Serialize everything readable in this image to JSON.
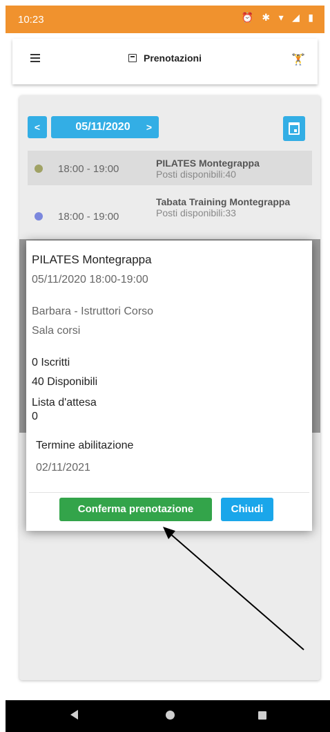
{
  "status_bar": {
    "time": "10:23",
    "icons": "⏰ ✱ ▾ ◢ ▮"
  },
  "header": {
    "title": "Prenotazioni",
    "menu_icon": "hamburger-icon",
    "calendar_icon": "calendar-icon",
    "right_icon": "fitness-icon"
  },
  "date_nav": {
    "prev": "<",
    "date": "05/11/2020",
    "next": ">"
  },
  "classes": [
    {
      "time": "18:00 - 19:00",
      "name": "PILATES Montegrappa",
      "seats": "Posti disponibili:40",
      "color": "#a0a265"
    },
    {
      "time": "18:00 - 19:00",
      "name": "Tabata Training Montegrappa",
      "seats": "Posti disponibili:33",
      "color": "#7b87dd"
    }
  ],
  "modal": {
    "title": "PILATES Montegrappa",
    "datetime": "05/11/2020 18:00-19:00",
    "instructor": "Barbara - Istruttori Corso",
    "room": "Sala corsi",
    "enrolled": "0 Iscritti",
    "available": "40 Disponibili",
    "waitlist_label": "Lista d'attesa",
    "waitlist_value": "0",
    "term_label": "Termine abilitazione",
    "term_date": "02/11/2021",
    "confirm_label": "Conferma prenotazione",
    "close_label": "Chiudi"
  },
  "colors": {
    "status_bar": "#f0922e",
    "primary": "#33aee5",
    "confirm": "#33a44a",
    "close": "#1aa6ea"
  }
}
